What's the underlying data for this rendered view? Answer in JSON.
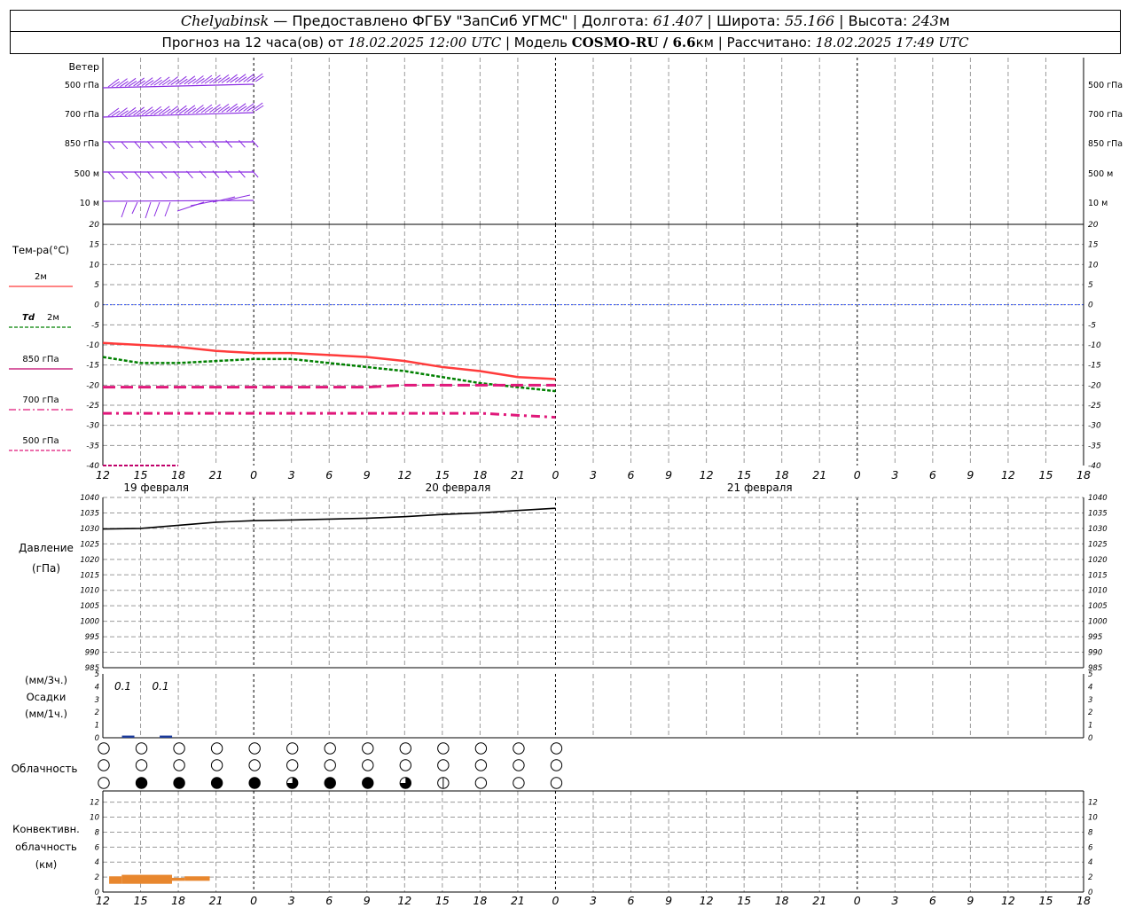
{
  "header": {
    "station": "Chelyabinsk",
    "provided_sep": " — ",
    "provided": "Предоставлено ФГБУ \"ЗапСиб УГМС\"",
    "sep": " | ",
    "lon_label": "Долгота: ",
    "lon_value": "61.407",
    "lat_label": "Широта: ",
    "lat_value": "55.166",
    "alt_label": "Высота: ",
    "alt_value": "243",
    "alt_unit": "м",
    "forecast_label": "Прогноз на 12 часа(ов) от ",
    "forecast_time": "18.02.2025 12:00 UTC",
    "model_label": " | Модель ",
    "model_value": "COSMO-RU / 6.6",
    "model_unit": "км",
    "calc_label": " | Рассчитано: ",
    "calc_time": "18.02.2025 17:49 UTC"
  },
  "x_axis": {
    "hours": [
      "12",
      "15",
      "18",
      "21",
      "0",
      "3",
      "6",
      "9",
      "12",
      "15",
      "18",
      "21",
      "0",
      "3",
      "6",
      "9",
      "12",
      "15",
      "18",
      "21",
      "0",
      "3",
      "6",
      "9",
      "12",
      "15",
      "18"
    ],
    "day_labels": [
      "19 февраля",
      "20 февраля",
      "21 февраля"
    ]
  },
  "wind_panel": {
    "title": "Ветер",
    "levels": [
      "500 гПа",
      "700 гПа",
      "850 гПа",
      "500 м",
      "10 м"
    ],
    "color": "#8a2be2"
  },
  "temperature_panel": {
    "title": "Тем-ра(°C)",
    "ticks": [
      "20",
      "15",
      "10",
      "5",
      "0",
      "-5",
      "-10",
      "-15",
      "-20",
      "-25",
      "-30",
      "-35",
      "-40"
    ],
    "legend": [
      {
        "label": "2м",
        "prefix": "",
        "color": "#ff3b3b",
        "dash": "solid"
      },
      {
        "label": "2м",
        "prefix": "Td",
        "color": "#008000",
        "dash": "dashed"
      },
      {
        "label": "850 гПа",
        "prefix": "",
        "color": "#c0006a",
        "dash": "solid"
      },
      {
        "label": "700 гПа",
        "prefix": "",
        "color": "#e0187a",
        "dash": "dashdot"
      },
      {
        "label": "500 гПа",
        "prefix": "",
        "color": "#e0187a",
        "dash": "dashed"
      }
    ]
  },
  "pressure_panel": {
    "title": "Давление",
    "unit": "(гПа)",
    "ticks": [
      "1040",
      "1035",
      "1030",
      "1025",
      "1020",
      "1015",
      "1010",
      "1005",
      "1000",
      "995",
      "990",
      "985"
    ]
  },
  "precip_panel": {
    "unit_top": "(мм/3ч.)",
    "title": "Осадки",
    "unit_bottom": "(мм/1ч.)",
    "ticks": [
      "5",
      "4",
      "3",
      "2",
      "1",
      "0"
    ],
    "labels": [
      "0.1",
      "0.1"
    ]
  },
  "cloud_panel": {
    "title": "Облачность",
    "rows": [
      [
        0,
        0,
        0,
        0,
        0,
        0,
        0,
        0,
        0,
        0,
        0,
        0,
        0
      ],
      [
        0,
        0,
        0,
        0,
        0,
        0,
        0,
        0,
        0,
        0,
        0,
        0,
        0
      ],
      [
        0,
        1,
        1,
        1,
        1,
        0.75,
        1,
        1,
        0.75,
        0.5,
        0,
        0,
        0
      ]
    ]
  },
  "convective_panel": {
    "title_line1": "Конвективн.",
    "title_line2": "облачность",
    "unit": "(км)",
    "ticks": [
      "12",
      "10",
      "8",
      "6",
      "4",
      "2",
      "0"
    ],
    "color": "#e8872e"
  },
  "chart_data": [
    {
      "type": "line",
      "name": "temperature",
      "x_hours": [
        0,
        1,
        2,
        3,
        4,
        5,
        6,
        7,
        8,
        9,
        10,
        11,
        12
      ],
      "ylim": [
        -40,
        20
      ],
      "series": [
        {
          "name": "2м",
          "values": [
            -9.5,
            -10,
            -10.5,
            -11.5,
            -12,
            -12,
            -12.5,
            -13,
            -14,
            -15.5,
            -16.5,
            -18,
            -18.5
          ]
        },
        {
          "name": "Td 2м",
          "values": [
            -13,
            -14.5,
            -14.5,
            -14,
            -13.5,
            -13.5,
            -14.5,
            -15.5,
            -16.5,
            -18,
            -19.5,
            -20.5,
            -21.5
          ]
        },
        {
          "name": "850 гПа",
          "values": [
            -20.5,
            -20.5,
            -20.5,
            -20.5,
            -20.5,
            -20.5,
            -20.5,
            -20.5,
            -20,
            -20,
            -20,
            -20,
            -20
          ]
        },
        {
          "name": "700 гПа",
          "values": [
            -27,
            -27,
            -27,
            -27,
            -27,
            -27,
            -27,
            -27,
            -27,
            -27,
            -27,
            -27.5,
            -28
          ]
        },
        {
          "name": "500 гПа",
          "values": [
            -40,
            -40,
            -40
          ]
        }
      ]
    },
    {
      "type": "line",
      "name": "pressure",
      "x_hours": [
        0,
        1,
        2,
        3,
        4,
        5,
        6,
        7,
        8,
        9,
        10,
        11,
        12
      ],
      "ylim": [
        985,
        1040
      ],
      "series": [
        {
          "name": "Давление",
          "values": [
            1029.8,
            1030,
            1031,
            1032,
            1032.5,
            1032.7,
            1033,
            1033.3,
            1033.8,
            1034.5,
            1035,
            1035.8,
            1036.5
          ]
        }
      ]
    },
    {
      "type": "bar",
      "name": "precipitation",
      "x_hours": [
        3,
        6
      ],
      "ylim": [
        0,
        5
      ],
      "values": [
        0.1,
        0.1
      ]
    },
    {
      "type": "bar",
      "name": "convective_clouds",
      "ylim": [
        0,
        12
      ],
      "segments": [
        {
          "x0": 0.5,
          "x1": 1.5,
          "base": 1.1,
          "top": 2.1
        },
        {
          "x0": 1.5,
          "x1": 5.5,
          "base": 1.1,
          "top": 2.3
        },
        {
          "x0": 5.5,
          "x1": 6.5,
          "base": 1.5,
          "top": 1.9
        },
        {
          "x0": 6.5,
          "x1": 8.5,
          "base": 1.5,
          "top": 2.1
        }
      ]
    }
  ]
}
